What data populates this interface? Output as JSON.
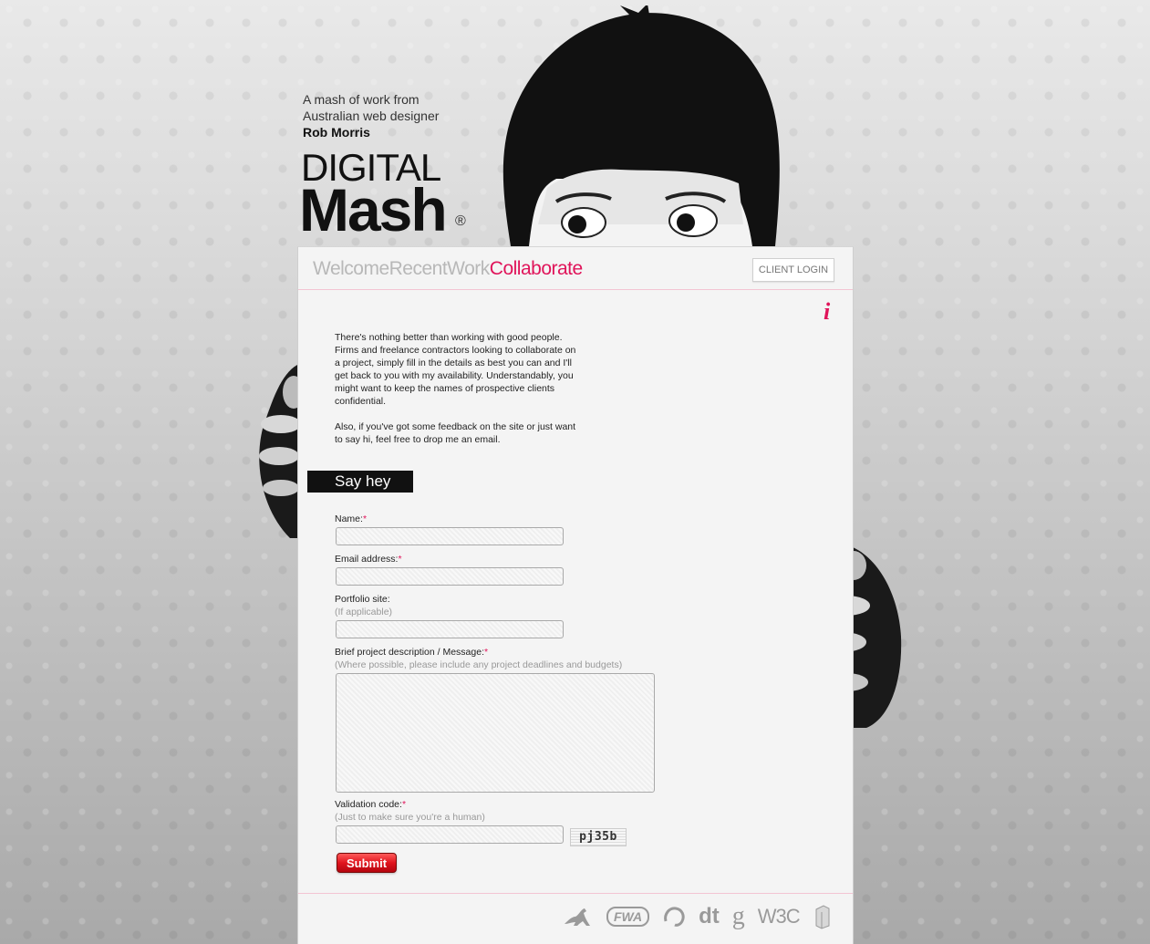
{
  "header": {
    "tagline_line1": "A mash of work from",
    "tagline_line2": "Australian web designer",
    "tagline_name": "Rob Morris",
    "logo_top": "DIGITAL",
    "logo_bottom": "Mash",
    "logo_reg": "®"
  },
  "nav": {
    "items": [
      {
        "label": "Welcome",
        "active": false
      },
      {
        "label": "RecentWork",
        "active": false
      },
      {
        "label": "Collaborate",
        "active": true
      }
    ],
    "client_login": "CLIENT LOGIN"
  },
  "info_icon": "i",
  "intro": {
    "paragraph1": "There's nothing better than working with good people. Firms and freelance contractors looking to collaborate on a project, simply fill in the details as best you can and I'll get back to you with my availability. Understandably, you might want to keep the names of prospective clients confidential.",
    "paragraph2": "Also, if you've got some feedback on the site or just want to say hi, feel free to drop me an email."
  },
  "section_title": "Say hey",
  "form": {
    "name_label": "Name:",
    "email_label": "Email address:",
    "portfolio_label": "Portfolio site:",
    "portfolio_hint": "(If applicable)",
    "message_label": "Brief project description / Message:",
    "message_hint": "(Where possible, please include any project deadlines and budgets)",
    "validation_label": "Validation code:",
    "validation_hint": "(Just to make sure you're a human)",
    "required_marker": "*",
    "captcha_text": "pj35b",
    "submit_label": "Submit",
    "name_value": "",
    "email_value": "",
    "portfolio_value": "",
    "message_value": "",
    "validation_value": ""
  },
  "footer": {
    "icons": [
      {
        "name": "kangaroo-icon",
        "glyph": "🦘"
      },
      {
        "name": "fwa-icon",
        "glyph": "FWA"
      },
      {
        "name": "swirl-icon",
        "glyph": "◌"
      },
      {
        "name": "dt-icon",
        "glyph": "dt"
      },
      {
        "name": "g-icon",
        "glyph": "g"
      },
      {
        "name": "w3c-icon",
        "glyph": "W3C"
      },
      {
        "name": "box-icon",
        "glyph": "▯"
      }
    ]
  },
  "colors": {
    "accent": "#e0145a",
    "nav_inactive": "#b8b8b8"
  }
}
